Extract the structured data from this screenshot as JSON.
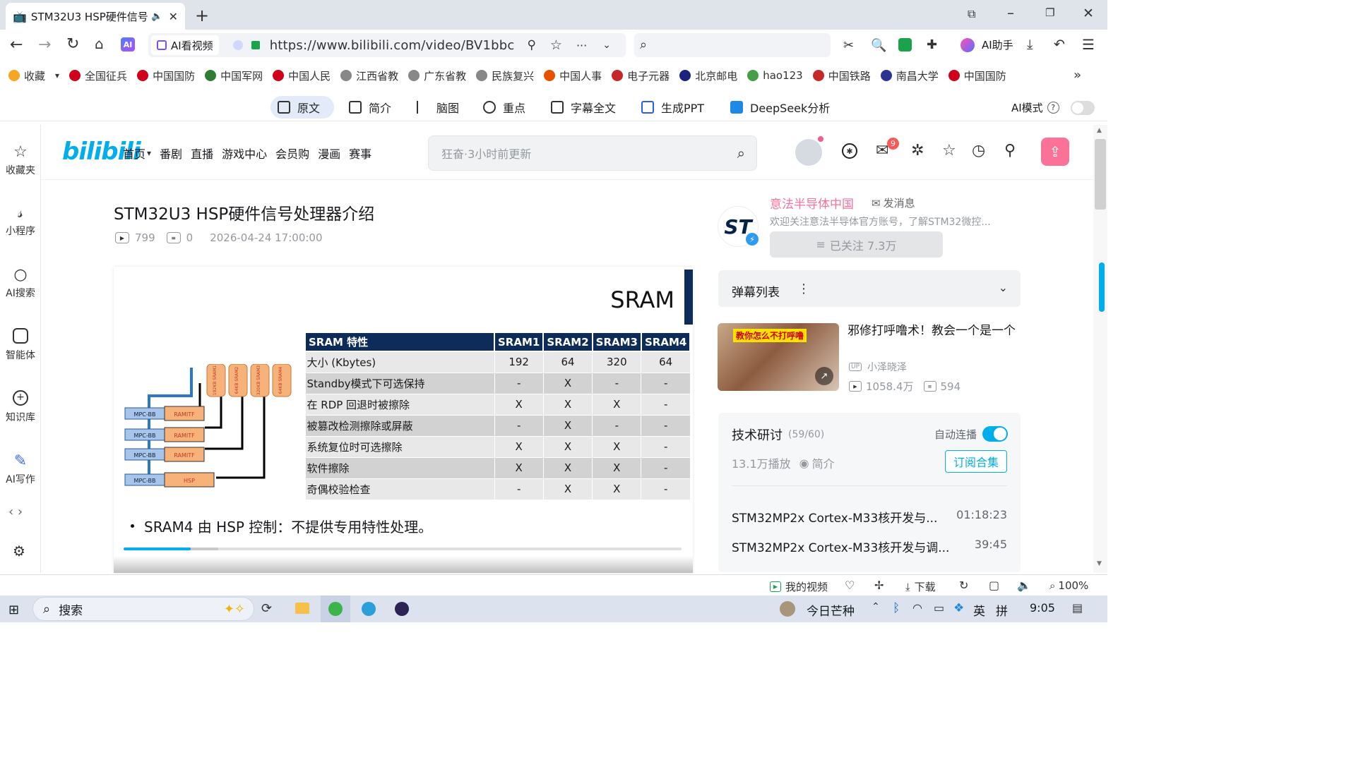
{
  "browser": {
    "tab_title": "STM32U3 HSP硬件信号",
    "url": "https://www.bilibili.com/video/BV1bbc",
    "ai_watch_label": "AI看视频",
    "ai_assistant_label": "AI助手"
  },
  "bookmarks": [
    {
      "label": "收藏",
      "color": "#f5a623"
    },
    {
      "label": "全国征兵",
      "color": "#d0021b"
    },
    {
      "label": "中国国防",
      "color": "#d0021b"
    },
    {
      "label": "中国军网",
      "color": "#2e7d32"
    },
    {
      "label": "中国人民",
      "color": "#d0021b"
    },
    {
      "label": "江西省教",
      "color": "#888888"
    },
    {
      "label": "广东省教",
      "color": "#888888"
    },
    {
      "label": "民族复兴",
      "color": "#888888"
    },
    {
      "label": "中国人事",
      "color": "#e65100"
    },
    {
      "label": "电子元器",
      "color": "#c62828"
    },
    {
      "label": "北京邮电",
      "color": "#1a237e"
    },
    {
      "label": "hao123",
      "color": "#43a047"
    },
    {
      "label": "中国铁路",
      "color": "#c62828"
    },
    {
      "label": "南昌大学",
      "color": "#283593"
    },
    {
      "label": "中国国防",
      "color": "#d0021b"
    }
  ],
  "ai_bar": {
    "tabs": [
      "原文",
      "简介",
      "脑图",
      "重点",
      "字幕全文",
      "生成PPT",
      "DeepSeek分析"
    ],
    "mode_label": "AI模式"
  },
  "rail": [
    "收藏夹",
    "小程序",
    "AI搜索",
    "智能体",
    "知识库",
    "AI写作"
  ],
  "bili": {
    "logo": "bilibili",
    "nav": [
      "首页",
      "番剧",
      "直播",
      "游戏中心",
      "会员购",
      "漫画",
      "赛事"
    ],
    "search_placeholder": "狂奋·3小时前更新",
    "msg_badge": "9",
    "upload_color": "#fb7299"
  },
  "video": {
    "title": "STM32U3 HSP硬件信号处理器介绍",
    "plays": "799",
    "comments": "0",
    "date": "2026-04-24 17:00:00",
    "progress": 0.12
  },
  "slide": {
    "heading": "SRAM",
    "columns": [
      "SRAM 特性",
      "SRAM1",
      "SRAM2",
      "SRAM3",
      "SRAM4"
    ],
    "rows": [
      [
        "大小 (Kbytes)",
        "192",
        "64",
        "320",
        "64"
      ],
      [
        "Standby模式下可选保持",
        "-",
        "X",
        "-",
        "-"
      ],
      [
        "在 RDP 回退时被擦除",
        "X",
        "X",
        "X",
        "-"
      ],
      [
        "被篡改检测擦除或屏蔽",
        "-",
        "X",
        "-",
        "-"
      ],
      [
        "系统复位时可选擦除",
        "X",
        "X",
        "X",
        "-"
      ],
      [
        "软件擦除",
        "X",
        "X",
        "X",
        "-"
      ],
      [
        "奇偶校验检查",
        "-",
        "X",
        "X",
        "-"
      ]
    ],
    "bullet": "SRAM4 由 HSP 控制：不提供专用特性处理。",
    "diagram": {
      "mpc": [
        "MPC-BB",
        "MPC-BB",
        "MPC-BB",
        "MPC-BB"
      ],
      "blocks": [
        "RAMITF",
        "RAMITF",
        "RAMITF",
        "HSP"
      ],
      "srams": [
        "192KB SRAM1",
        "64KB SRAM2",
        "320KB SRAM3",
        "64KB SRAM4"
      ]
    }
  },
  "uploader": {
    "name": "意法半导体中国",
    "send_msg": "发消息",
    "desc": "欢迎关注意法半导体官方账号，了解STM32微控...",
    "follow_label": "已关注 7.3万"
  },
  "danmu_label": "弹幕列表",
  "recommend": {
    "title": "邪修打呼噜术！教会一个是一个",
    "thumb_text": "教你怎么不打呼噜",
    "author": "小泽晓泽",
    "plays": "1058.4万",
    "danmaku": "594"
  },
  "collection": {
    "title": "技术研讨",
    "count": "(59/60)",
    "autoplay": "自动连播",
    "plays": "13.1万播放",
    "intro": "简介",
    "subscribe": "订阅合集",
    "items": [
      {
        "title": "STM32MP2x Cortex-M33核开发与...",
        "duration": "01:18:23"
      },
      {
        "title": "STM32MP2x Cortex-M33核开发与调...",
        "duration": "39:45"
      }
    ]
  },
  "statusbar": {
    "my_video": "我的视频",
    "download": "下载",
    "zoom": "100%"
  },
  "taskbar": {
    "search": "搜索",
    "weather": "今日芒种",
    "ime": "英",
    "ime2": "拼",
    "time": "9:05"
  }
}
